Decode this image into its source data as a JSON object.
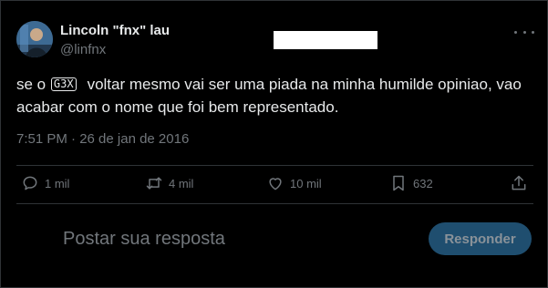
{
  "author": {
    "display_name": "Lincoln \"fnx\" lau",
    "handle": "@linfnx"
  },
  "tweet": {
    "text_before": "se o",
    "emoji_label": "G3X",
    "text_after": "voltar mesmo vai ser uma piada na minha humilde opiniao, vao acabar com o nome que foi bem representado.",
    "timestamp": "7:51 PM · 26 de jan de 2016"
  },
  "actions": {
    "replies": "1 mil",
    "retweets": "4 mil",
    "likes": "10 mil",
    "bookmarks": "632"
  },
  "reply_box": {
    "placeholder": "Postar sua resposta",
    "button_label": "Responder"
  },
  "icons": [
    "more-icon",
    "reply-icon",
    "retweet-icon",
    "like-icon",
    "bookmark-icon",
    "share-icon"
  ],
  "colors": {
    "background": "#000000",
    "text": "#e7e9ea",
    "muted": "#71767b",
    "button_bg": "#1f4e6f"
  }
}
